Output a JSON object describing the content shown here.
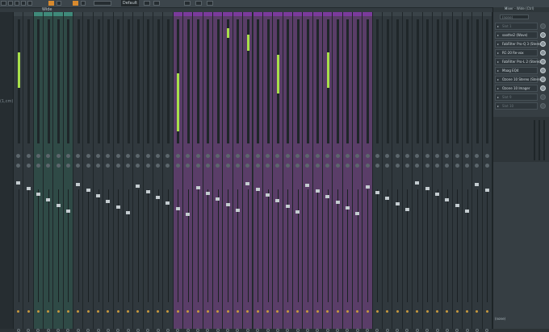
{
  "colors": {
    "purple_group": "#5a3d68",
    "purple_header": "#7b3a9c",
    "teal_group": "#2f4a46",
    "teal_header": "#3f8a7a",
    "meter_green": "#a8e04a",
    "orange_accent": "#d88a2e"
  },
  "toolbar": {
    "preset_label": "Default",
    "icons": [
      "arrow-icon",
      "speaker-icon",
      "mixer-icon",
      "grid-icon",
      "brush-icon",
      "select-icon",
      "dropdown-icon",
      "snap-icon",
      "wave-icon",
      "cursor-icon",
      "pen-icon",
      "scissors-icon",
      "zoom-icon",
      "mute-icon",
      "slice-icon"
    ]
  },
  "mixer": {
    "title": "Wide",
    "left_label": "(1,cm)",
    "tracks": [
      {
        "group": "normal",
        "meter": 0.55
      },
      {
        "group": "normal",
        "meter": 0
      },
      {
        "group": "teal",
        "meter": 0
      },
      {
        "group": "teal",
        "meter": 0
      },
      {
        "group": "teal",
        "meter": 0
      },
      {
        "group": "teal",
        "meter": 0
      },
      {
        "group": "normal",
        "meter": 0
      },
      {
        "group": "normal",
        "meter": 0
      },
      {
        "group": "normal",
        "meter": 0
      },
      {
        "group": "normal",
        "meter": 0
      },
      {
        "group": "normal",
        "meter": 0
      },
      {
        "group": "normal",
        "meter": 0
      },
      {
        "group": "normal",
        "meter": 0
      },
      {
        "group": "normal",
        "meter": 0
      },
      {
        "group": "normal",
        "meter": 0
      },
      {
        "group": "normal",
        "meter": 0
      },
      {
        "group": "purple",
        "meter": 0.9
      },
      {
        "group": "purple",
        "meter": 0
      },
      {
        "group": "purple",
        "meter": 0
      },
      {
        "group": "purple",
        "meter": 0
      },
      {
        "group": "purple",
        "meter": 0
      },
      {
        "group": "purple",
        "meter": 0.15
      },
      {
        "group": "purple",
        "meter": 0
      },
      {
        "group": "purple",
        "meter": 0.25
      },
      {
        "group": "purple",
        "meter": 0
      },
      {
        "group": "purple",
        "meter": 0
      },
      {
        "group": "purple",
        "meter": 0.6
      },
      {
        "group": "purple",
        "meter": 0
      },
      {
        "group": "purple",
        "meter": 0
      },
      {
        "group": "purple",
        "meter": 0
      },
      {
        "group": "purple",
        "meter": 0
      },
      {
        "group": "purple",
        "meter": 0.55
      },
      {
        "group": "purple",
        "meter": 0
      },
      {
        "group": "purple",
        "meter": 0
      },
      {
        "group": "purple",
        "meter": 0
      },
      {
        "group": "purple",
        "meter": 0
      },
      {
        "group": "normal",
        "meter": 0
      },
      {
        "group": "normal",
        "meter": 0
      },
      {
        "group": "normal",
        "meter": 0
      },
      {
        "group": "normal",
        "meter": 0
      },
      {
        "group": "normal",
        "meter": 0
      },
      {
        "group": "normal",
        "meter": 0
      },
      {
        "group": "normal",
        "meter": 0
      },
      {
        "group": "normal",
        "meter": 0
      },
      {
        "group": "normal",
        "meter": 0
      },
      {
        "group": "normal",
        "meter": 0
      },
      {
        "group": "normal",
        "meter": 0
      },
      {
        "group": "normal",
        "meter": 0
      }
    ]
  },
  "effects_panel": {
    "title": "Mixer - Wide (Ctrl)",
    "input_label": "(none)",
    "slots": [
      {
        "label": "Slot 1",
        "active": false
      },
      {
        "label": "soothe2 (Wave)",
        "active": true
      },
      {
        "label": "FabFilter Pro-Q 3 (Stereo)",
        "active": true
      },
      {
        "label": "RC-20 Re-vox",
        "active": true
      },
      {
        "label": "FabFilter Pro-L 2 (Stereo)",
        "active": true
      },
      {
        "label": "Maag EQ4",
        "active": true
      },
      {
        "label": "Ozone 10 Stereo (Stereo)",
        "active": true
      },
      {
        "label": "Ozone 10 Imager",
        "active": true
      },
      {
        "label": "Slot 9",
        "active": false
      },
      {
        "label": "Slot 10",
        "active": false
      }
    ],
    "bottom_label": "(none)"
  }
}
